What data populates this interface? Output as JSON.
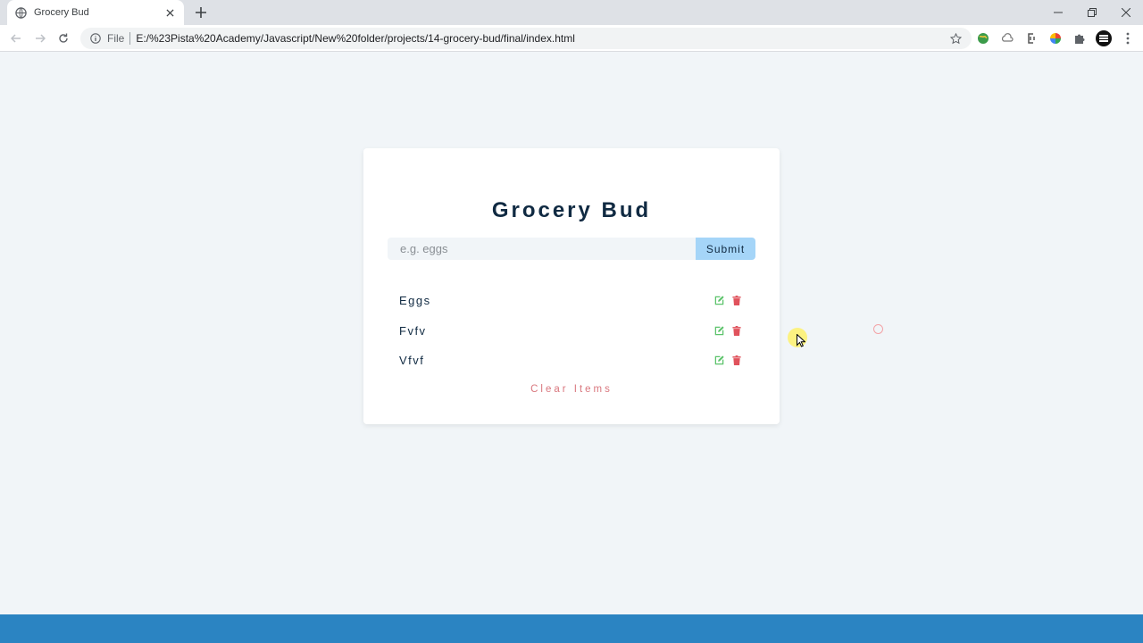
{
  "browser": {
    "tab": {
      "title": "Grocery Bud"
    },
    "address": {
      "scheme_label": "File",
      "url": "E:/%23Pista%20Academy/Javascript/New%20folder/projects/14-grocery-bud/final/index.html"
    }
  },
  "app": {
    "title": "Grocery Bud",
    "input": {
      "placeholder": "e.g. eggs",
      "value": ""
    },
    "submit_label": "Submit",
    "items": [
      {
        "title": "Eggs"
      },
      {
        "title": "Fvfv"
      },
      {
        "title": "Vfvf"
      }
    ],
    "clear_label": "Clear Items"
  },
  "colors": {
    "page_bg": "#f1f5f8",
    "title": "#102a42",
    "submit_bg": "#a5d5f8",
    "edit_icon": "#5cc36b",
    "delete_icon": "#e0525c",
    "clear_text": "#d9777e",
    "taskbar": "#2b84c2"
  },
  "icons": {
    "edit": "edit-icon",
    "delete": "trash-icon"
  }
}
